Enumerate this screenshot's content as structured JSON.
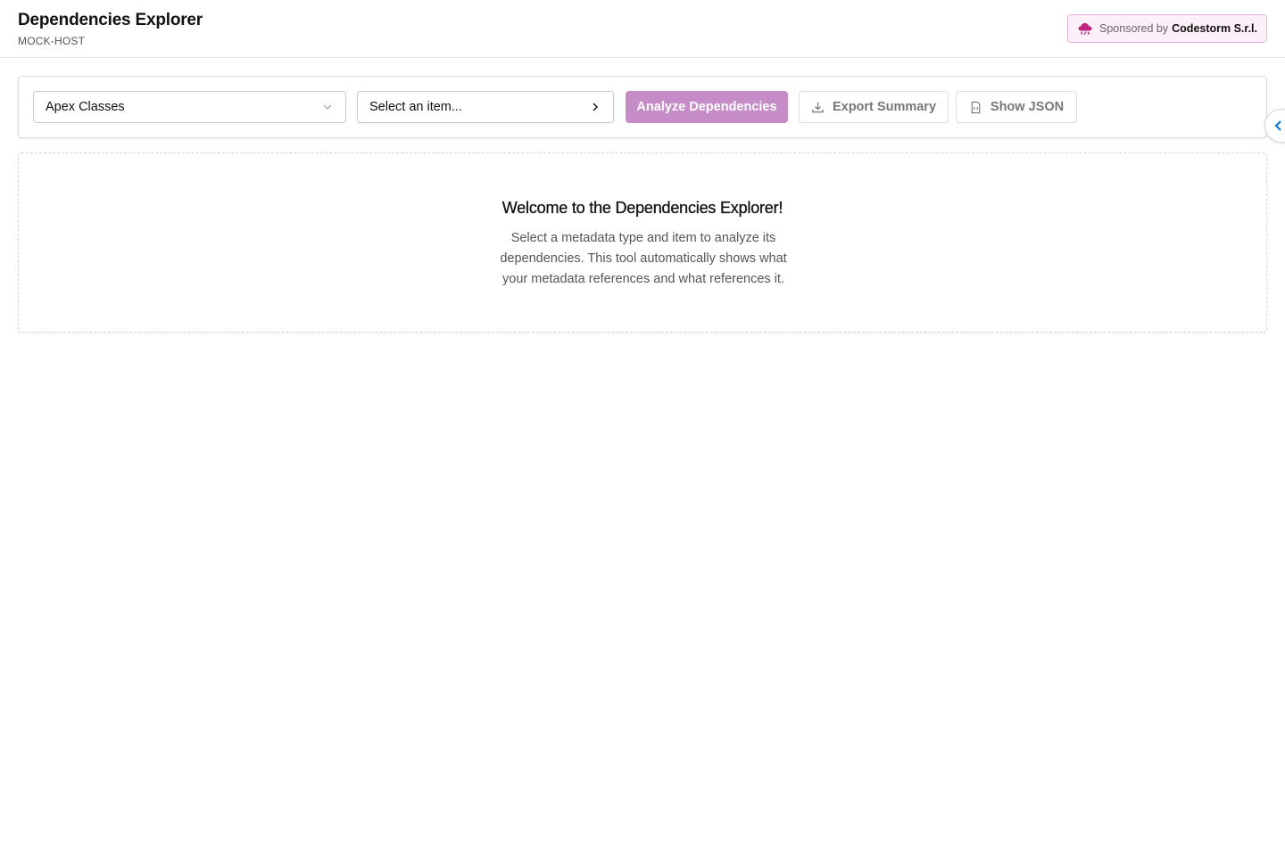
{
  "header": {
    "title": "Dependencies Explorer",
    "host": "MOCK-HOST",
    "sponsor": {
      "prefix": "Sponsored by",
      "brand": "Codestorm S.r.l.",
      "icon": "cloud-code-icon",
      "accent": "#c0267f"
    }
  },
  "toolbar": {
    "type_select": {
      "value": "Apex Classes",
      "icon": "chevron-down-icon"
    },
    "item_picker": {
      "placeholder": "Select an item...",
      "icon": "chevron-right-icon"
    },
    "analyze_label": "Analyze Dependencies",
    "export_label": "Export Summary",
    "export_icon": "download-icon",
    "json_label": "Show JSON",
    "json_icon": "file-code-icon"
  },
  "side_panel_toggle": {
    "icon": "chevron-left-icon",
    "color": "#0176d3"
  },
  "welcome": {
    "title": "Welcome to the Dependencies Explorer!",
    "text": "Select a metadata type and item to analyze its dependencies. This tool automatically shows what your metadata references and what references it."
  },
  "colors": {
    "primary_button": "#c58cc8",
    "sponsor_background": "#fdf0f8",
    "sponsor_border": "#e9b6da"
  }
}
